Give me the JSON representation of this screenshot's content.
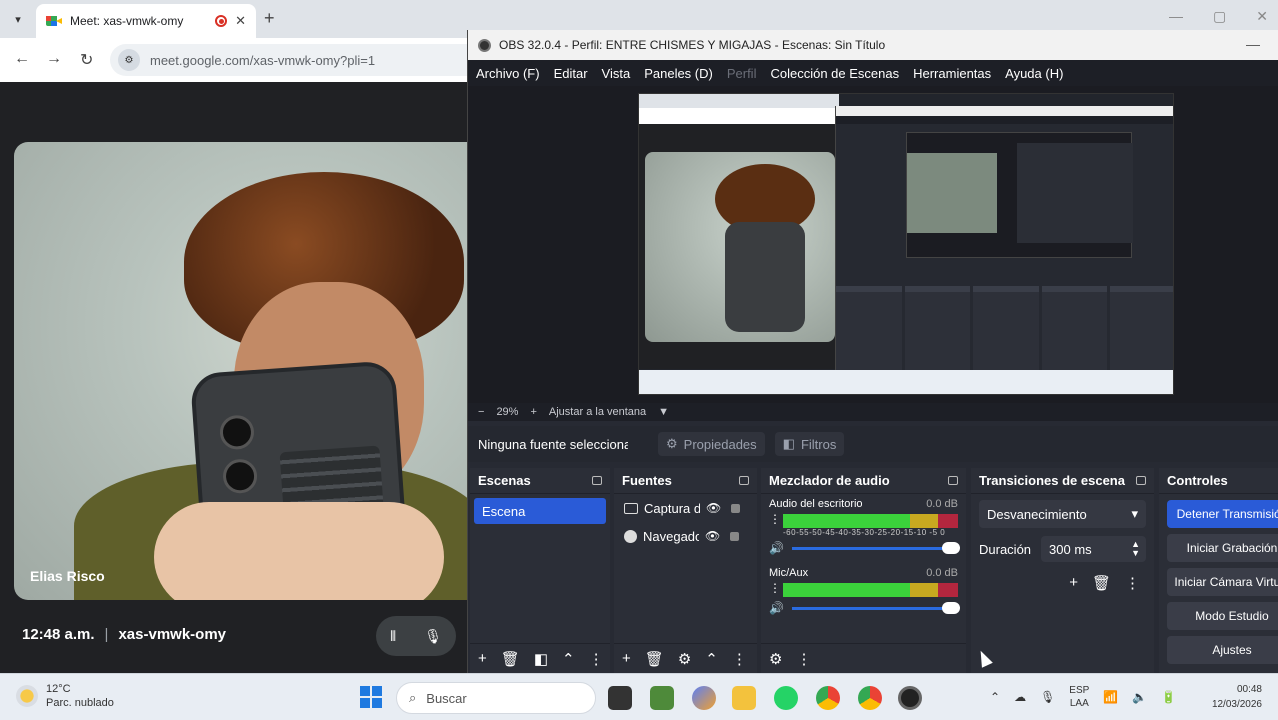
{
  "chrome": {
    "tab_title": "Meet: xas-vmwk-omy",
    "url": "meet.google.com/xas-vmwk-omy?pli=1"
  },
  "meet": {
    "participant_name": "Elias Risco",
    "time": "12:48 a.m.",
    "separator": "|",
    "meeting_code": "xas-vmwk-omy"
  },
  "obs": {
    "title": "OBS 32.0.4 - Perfil: ENTRE CHISMES Y MIGAJAS - Escenas: Sin Título",
    "menu": [
      "Archivo (F)",
      "Editar",
      "Vista",
      "Paneles (D)",
      "Perfil",
      "Colección de Escenas",
      "Herramientas",
      "Ayuda (H)"
    ],
    "zoom": "29%",
    "zoom_fit": "Ajustar a la ventana",
    "no_source": "Ninguna fuente seleccionada",
    "properties": "Propiedades",
    "filters": "Filtros",
    "docks": {
      "scenes_title": "Escenas",
      "scene_item": "Escena",
      "sources_title": "Fuentes",
      "sources": [
        "Captura de pantalla",
        "Navegador"
      ],
      "mixer_title": "Mezclador de audio",
      "channels": [
        {
          "name": "Audio del escritorio",
          "db": "0.0 dB"
        },
        {
          "name": "Mic/Aux",
          "db": "0.0 dB"
        }
      ],
      "meter_ticks": "-60-55-50-45-40-35-30-25-20-15-10 -5 0",
      "transitions_title": "Transiciones de escena",
      "transition": "Desvanecimiento",
      "duration_label": "Duración",
      "duration_value": "300 ms",
      "controls_title": "Controles",
      "controls": [
        "Detener Transmisión",
        "Iniciar Grabación",
        "Iniciar Cámara Virtual",
        "Modo Estudio",
        "Ajustes"
      ]
    }
  },
  "taskbar": {
    "temperature": "12°C",
    "weather": "Parc. nublado",
    "search": "Buscar",
    "lang_top": "ESP",
    "lang_bottom": "LAA",
    "time": "00:48",
    "date": "12/03/2026"
  },
  "colors": {
    "obs_accent": "#2a5bd7",
    "meter_green": "#3bd23b",
    "meter_yellow": "#c8a920",
    "meter_red": "#b3263e"
  }
}
